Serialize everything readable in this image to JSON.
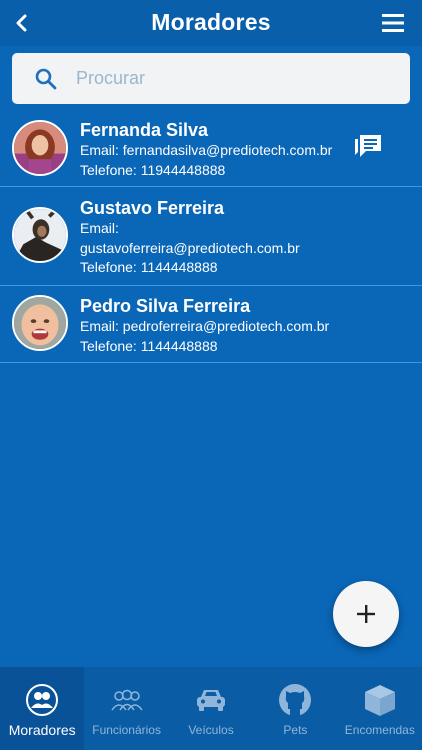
{
  "header": {
    "title": "Moradores",
    "back_icon": "chevron-left-icon",
    "menu_icon": "hamburger-menu-icon"
  },
  "search": {
    "placeholder": "Procurar",
    "value": ""
  },
  "residents": [
    {
      "name": "Fernanda Silva",
      "email_line": "Email: fernandasilva@prediotech.com.br",
      "phone_line": "Telefone: 11944448888",
      "has_chat": true
    },
    {
      "name": "Gustavo Ferreira",
      "email_label": "Email:",
      "email": "gustavoferreira@prediotech.com.br",
      "phone_line": "Telefone: 1144448888"
    },
    {
      "name": "Pedro Silva Ferreira",
      "email_line": "Email: pedroferreira@prediotech.com.br",
      "phone_line": "Telefone: 1144448888"
    }
  ],
  "fab": {
    "icon": "plus-icon"
  },
  "bottom_nav": [
    {
      "label": "Moradores",
      "icon": "residents-icon",
      "active": true
    },
    {
      "label": "Funcionários",
      "icon": "staff-icon"
    },
    {
      "label": "Veículos",
      "icon": "car-icon"
    },
    {
      "label": "Pets",
      "icon": "github-cat-icon"
    },
    {
      "label": "Encomendas",
      "icon": "package-icon"
    }
  ],
  "colors": {
    "background": "#0a66b7",
    "header": "#0a5fab",
    "divider": "#3b9be0",
    "nav_inactive": "#8fb6da"
  }
}
